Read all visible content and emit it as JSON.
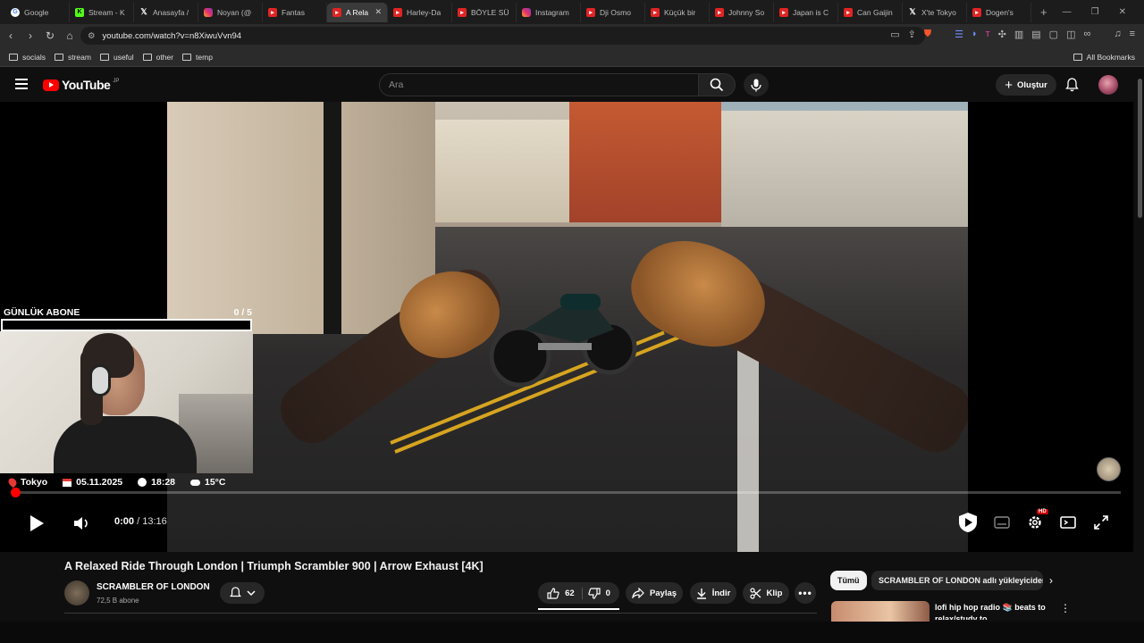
{
  "browser": {
    "tabs": [
      {
        "label": "Google",
        "icon": "google-icon",
        "fav": "g",
        "active": false
      },
      {
        "label": "Stream - K",
        "icon": "kick-icon",
        "fav": "k",
        "active": false
      },
      {
        "label": "Anasayfa /",
        "icon": "x-icon",
        "fav": "x",
        "active": false
      },
      {
        "label": "Noyan (@",
        "icon": "instagram-icon",
        "fav": "ig",
        "active": false
      },
      {
        "label": "Fantas",
        "icon": "youtube-icon",
        "fav": "yt",
        "active": false
      },
      {
        "label": "A Rela",
        "icon": "youtube-icon",
        "fav": "yt",
        "active": true
      },
      {
        "label": "Harley-Da",
        "icon": "youtube-icon",
        "fav": "yt",
        "active": false
      },
      {
        "label": "BÖYLE SÜ",
        "icon": "youtube-icon",
        "fav": "yt",
        "active": false
      },
      {
        "label": "Instagram",
        "icon": "instagram-icon",
        "fav": "ig",
        "active": false
      },
      {
        "label": "Dji Osmo",
        "icon": "youtube-icon",
        "fav": "yt",
        "active": false
      },
      {
        "label": "Küçük bir",
        "icon": "youtube-icon",
        "fav": "yt",
        "active": false
      },
      {
        "label": "Johnny So",
        "icon": "youtube-icon",
        "fav": "yt",
        "active": false
      },
      {
        "label": "Japan is C",
        "icon": "youtube-icon",
        "fav": "yt",
        "active": false
      },
      {
        "label": "Can Gaijin",
        "icon": "youtube-icon",
        "fav": "yt",
        "active": false
      },
      {
        "label": "X'te Tokyo",
        "icon": "x-icon",
        "fav": "x",
        "active": false
      },
      {
        "label": "Dogen's",
        "icon": "youtube-icon",
        "fav": "yt",
        "active": false
      }
    ],
    "url": "youtube.com/watch?v=n8XiwuVvn94",
    "bookmarks": [
      "socials",
      "stream",
      "useful",
      "other",
      "temp"
    ],
    "all_bookmarks": "All Bookmarks"
  },
  "youtube": {
    "logo_text": "YouTube",
    "region": "JP",
    "search_placeholder": "Ara",
    "create_label": "Oluştur"
  },
  "overlay": {
    "sub_goal_label": "GÜNLÜK ABONE",
    "sub_goal_count": "0  / 5",
    "sub_goal_fraction": 0,
    "location": "Tokyo",
    "date": "05.11.2025",
    "time": "18:28",
    "weather": "15°C"
  },
  "player": {
    "current_time": "0:00",
    "separator": " / ",
    "duration": "13:16",
    "progress_fraction": 0.003,
    "hd_badge": "HD"
  },
  "video": {
    "title": "A Relaxed Ride Through London | Triumph Scrambler 900 | Arrow Exhaust [4K]",
    "channel": "SCRAMBLER OF LONDON",
    "subscribers": "72,5 B abone",
    "likes": "62",
    "dislikes": "0",
    "share_label": "Paylaş",
    "download_label": "İndir",
    "clip_label": "Klip"
  },
  "sidebar": {
    "chips": [
      "Tümü",
      "SCRAMBLER OF LONDON adlı yükleyiciden"
    ],
    "rec_title": "lofi hip hop radio 📚 beats to relax/study to"
  },
  "colors": {
    "accent": "#ff0000",
    "background": "#0f0f0f"
  }
}
